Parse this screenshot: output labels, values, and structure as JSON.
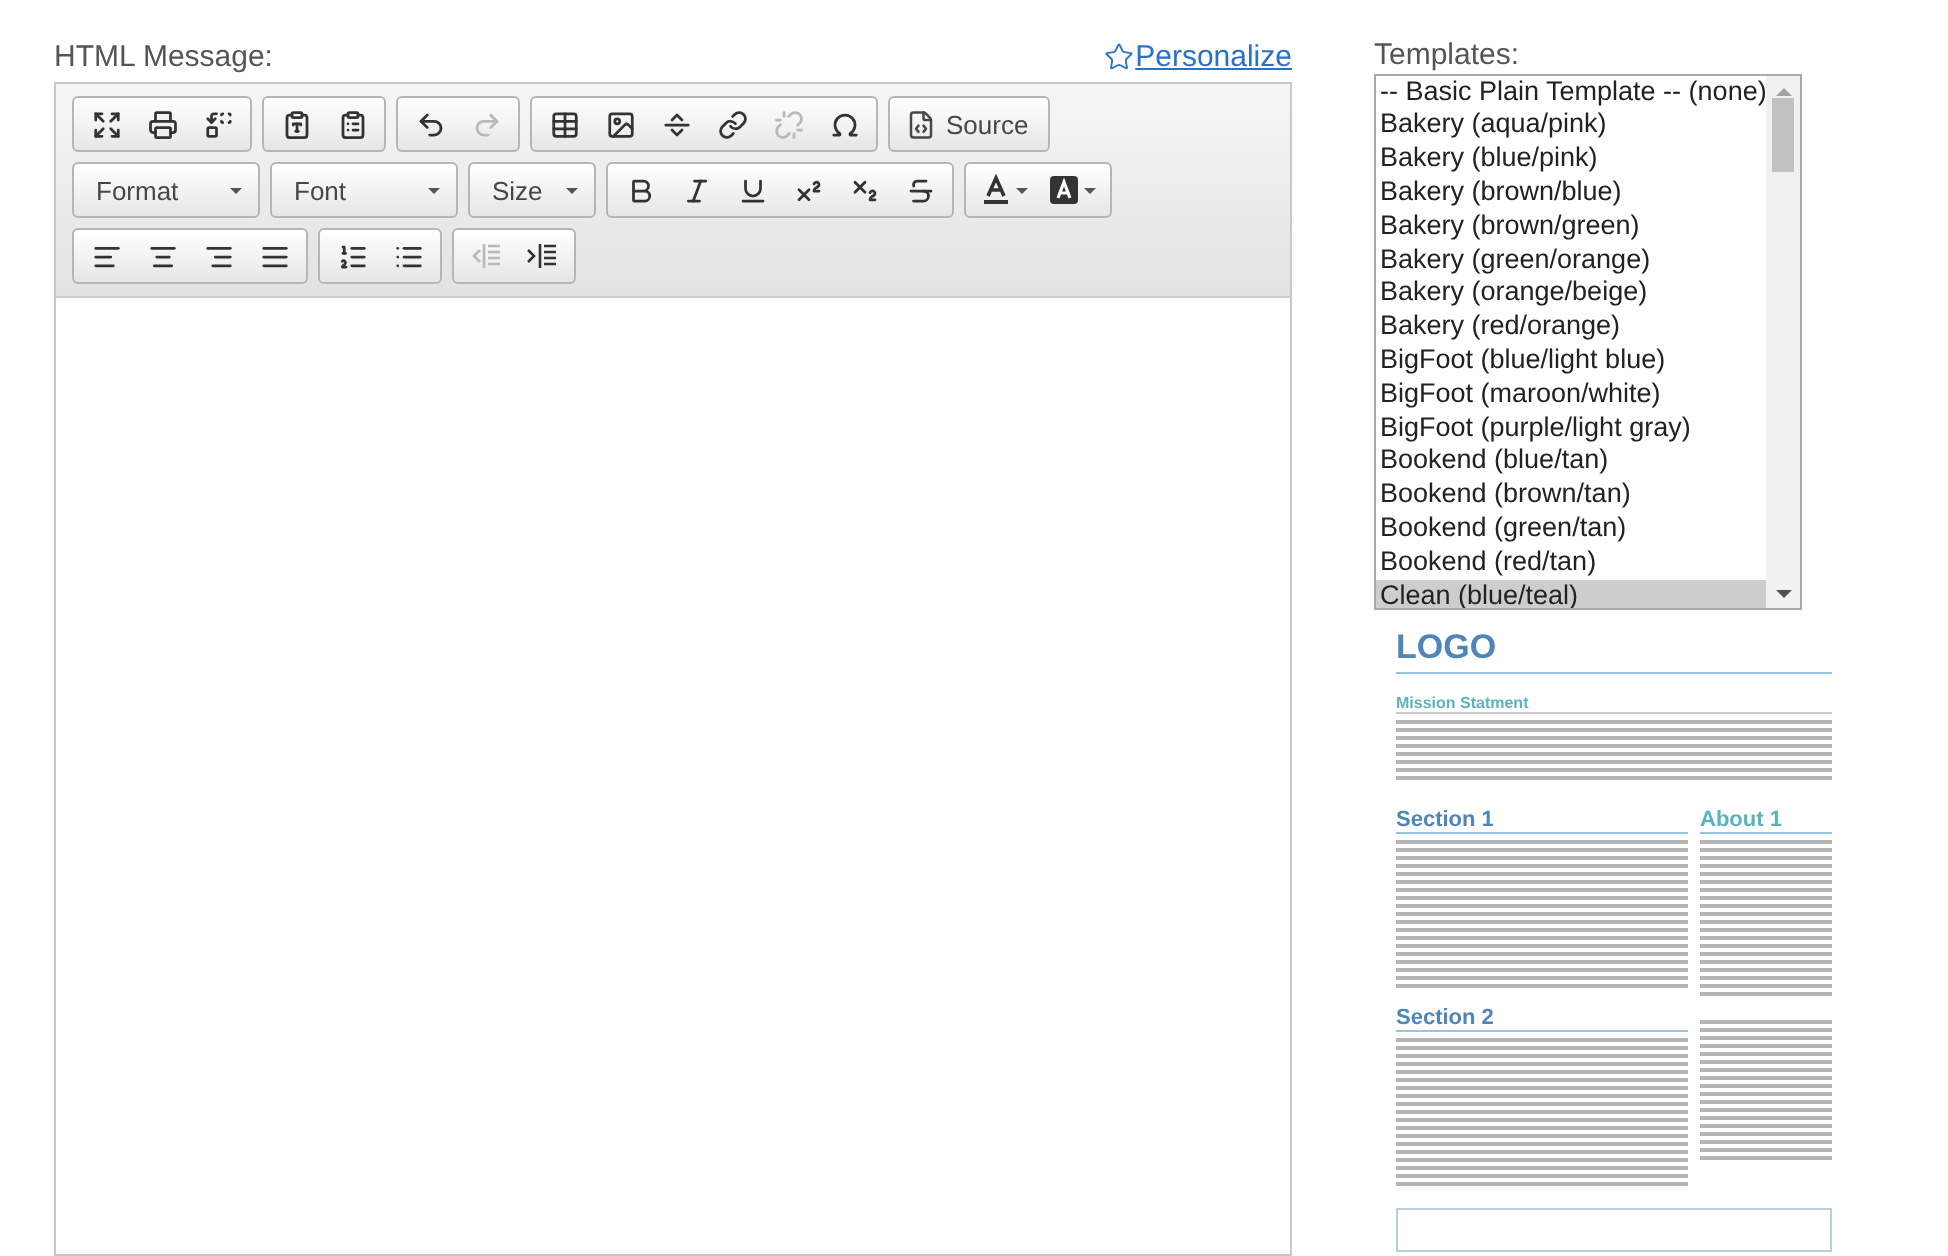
{
  "editor": {
    "label": "HTML Message:",
    "personalize_link": "Personalize",
    "toolbar": [
      [
        [
          {
            "kind": "icon",
            "disabled": false
          },
          {
            "kind": "icon",
            "disabled": false
          },
          {
            "kind": "icon",
            "disabled": false
          }
        ],
        [
          {
            "kind": "icon",
            "disabled": false
          },
          {
            "kind": "icon",
            "disabled": false
          }
        ],
        [
          {
            "kind": "icon",
            "disabled": false
          },
          {
            "kind": "icon",
            "disabled": true
          }
        ],
        [
          {
            "kind": "icon",
            "disabled": false
          },
          {
            "kind": "icon",
            "disabled": false
          },
          {
            "kind": "icon",
            "disabled": false
          },
          {
            "kind": "icon",
            "disabled": false
          },
          {
            "kind": "icon",
            "disabled": true
          },
          {
            "kind": "icon",
            "disabled": false
          }
        ],
        [
          {
            "kind": "text",
            "label": "Source",
            "disabled": false
          }
        ]
      ],
      [
        [
          {
            "kind": "dropdown",
            "label": "Format",
            "disabled": false
          }
        ],
        [
          {
            "kind": "dropdown",
            "label": "Font",
            "disabled": false
          }
        ],
        [
          {
            "kind": "dropdown",
            "label": "Size",
            "disabled": false
          }
        ],
        [
          {
            "kind": "icon",
            "disabled": false
          },
          {
            "kind": "icon",
            "disabled": false
          },
          {
            "kind": "icon",
            "disabled": false
          },
          {
            "kind": "icon",
            "disabled": false
          },
          {
            "kind": "icon",
            "disabled": false
          },
          {
            "kind": "icon",
            "disabled": false
          }
        ],
        [
          {
            "kind": "color",
            "disabled": false
          },
          {
            "kind": "color",
            "disabled": false
          }
        ]
      ],
      [
        [
          {
            "kind": "icon",
            "disabled": false
          },
          {
            "kind": "icon",
            "disabled": false
          },
          {
            "kind": "icon",
            "disabled": false
          },
          {
            "kind": "icon",
            "disabled": false
          }
        ],
        [
          {
            "kind": "icon",
            "disabled": false
          },
          {
            "kind": "icon",
            "disabled": false
          }
        ],
        [
          {
            "kind": "icon",
            "disabled": true
          },
          {
            "kind": "icon",
            "disabled": false
          }
        ]
      ]
    ]
  },
  "templates": {
    "label": "Templates:",
    "items": [
      {
        "label": "-- Basic Plain Template -- (none)",
        "selected": false
      },
      {
        "label": "Bakery (aqua/pink)",
        "selected": false
      },
      {
        "label": "Bakery (blue/pink)",
        "selected": false
      },
      {
        "label": "Bakery (brown/blue)",
        "selected": false
      },
      {
        "label": "Bakery (brown/green)",
        "selected": false
      },
      {
        "label": "Bakery (green/orange)",
        "selected": false
      },
      {
        "label": "Bakery (orange/beige)",
        "selected": false
      },
      {
        "label": "Bakery (red/orange)",
        "selected": false
      },
      {
        "label": "BigFoot (blue/light blue)",
        "selected": false
      },
      {
        "label": "BigFoot (maroon/white)",
        "selected": false
      },
      {
        "label": "BigFoot (purple/light gray)",
        "selected": false
      },
      {
        "label": "Bookend (blue/tan)",
        "selected": false
      },
      {
        "label": "Bookend (brown/tan)",
        "selected": false
      },
      {
        "label": "Bookend (green/tan)",
        "selected": false
      },
      {
        "label": "Bookend (red/tan)",
        "selected": false
      },
      {
        "label": "Clean (blue/teal)",
        "selected": true
      }
    ]
  },
  "preview": {
    "logo": "LOGO",
    "mission_heading": "Mission Statment",
    "sections": [
      "Section 1",
      "Section 2"
    ],
    "aside_heading": "About 1"
  }
}
